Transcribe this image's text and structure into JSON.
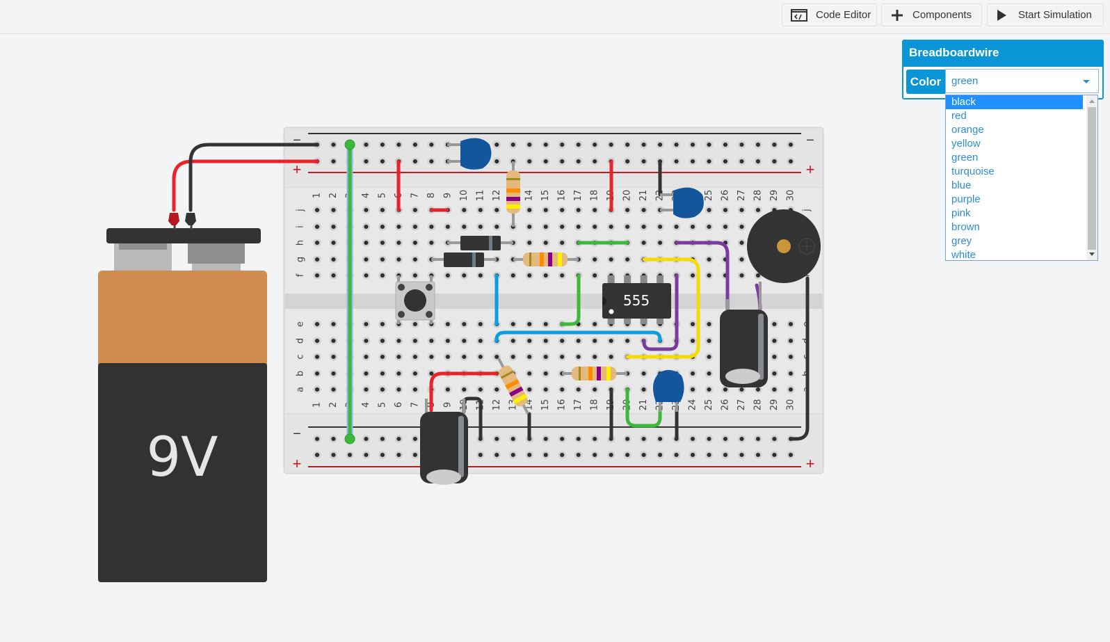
{
  "toolbar": {
    "code_editor": "Code Editor",
    "components": "Components",
    "start_simulation": "Start Simulation"
  },
  "panel": {
    "title": "Breadboardwire",
    "color_label": "Color",
    "color_value": "green",
    "options": [
      "black",
      "red",
      "orange",
      "yellow",
      "green",
      "turquoise",
      "blue",
      "purple",
      "pink",
      "brown",
      "grey",
      "white"
    ],
    "highlighted_option": "black"
  },
  "breadboard": {
    "columns": [
      "1",
      "2",
      "3",
      "4",
      "5",
      "6",
      "7",
      "8",
      "9",
      "10",
      "11",
      "12",
      "13",
      "14",
      "15",
      "16",
      "17",
      "18",
      "19",
      "20",
      "21",
      "22",
      "23",
      "24",
      "25",
      "26",
      "27",
      "28",
      "29",
      "30"
    ],
    "top_rows": [
      "j",
      "i",
      "h",
      "g",
      "f"
    ],
    "bottom_rows": [
      "e",
      "d",
      "c",
      "b",
      "a"
    ],
    "rail_minus": "−",
    "rail_plus": "+"
  },
  "chip": {
    "label": "555"
  },
  "battery": {
    "label": "9V"
  },
  "colors": {
    "accent": "#0a96d6",
    "wire_red": "#e8242a",
    "wire_black": "#333333",
    "wire_green": "#3cb93c",
    "wire_blue": "#0a9ee0",
    "wire_yellow": "#f5dc00",
    "wire_purple": "#7b3aa0"
  }
}
